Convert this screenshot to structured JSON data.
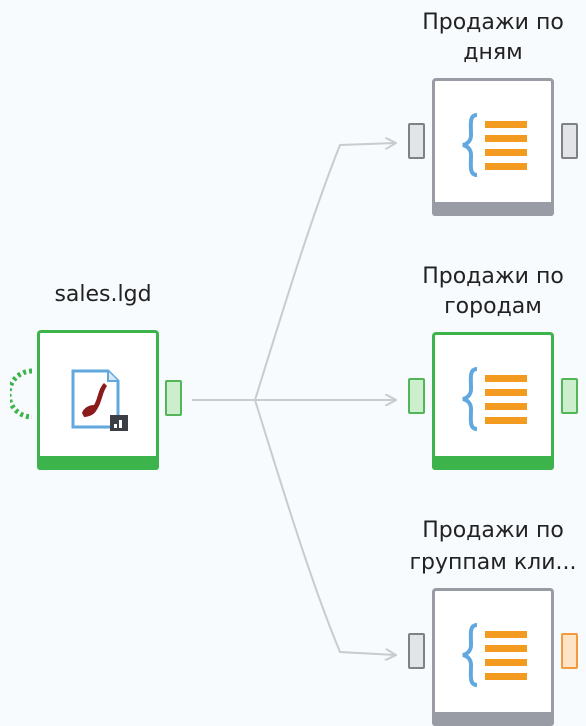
{
  "source_node": {
    "label": "sales.lgd",
    "icon": "pipe-document-icon",
    "status_color": "#3cb44b"
  },
  "target_nodes": [
    {
      "label_line1": "Продажи по",
      "label_line2": "дням",
      "icon": "json-list-icon",
      "status_color": "#9a9ca5",
      "output_port": "gray"
    },
    {
      "label_line1": "Продажи по",
      "label_line2": "городам",
      "icon": "json-list-icon",
      "status_color": "#3cb44b",
      "output_port": "green"
    },
    {
      "label_line1": "Продажи по",
      "label_line2": "группам кли...",
      "icon": "json-list-icon",
      "status_color": "#9a9ca5",
      "output_port": "orange"
    }
  ],
  "colors": {
    "link": "#c9cbce",
    "brace": "#62a8de",
    "lines": "#f39a21",
    "document_fill": "#8b1a1a"
  }
}
